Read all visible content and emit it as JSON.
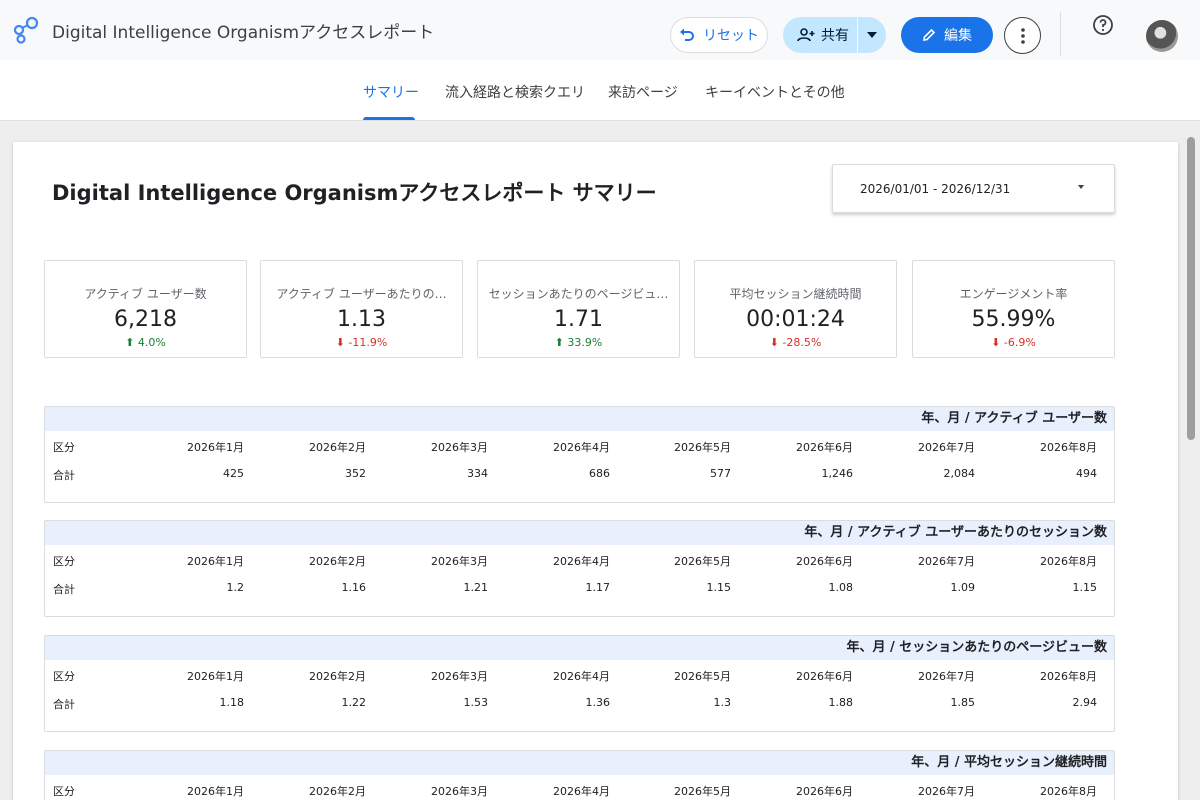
{
  "header": {
    "app_title": "Digital Intelligence Organismアクセスレポート",
    "reset_label": "リセット",
    "share_label": "共有",
    "edit_label": "編集"
  },
  "tabs": [
    {
      "label": "サマリー",
      "active": true
    },
    {
      "label": "流入経路と検索クエリ",
      "active": false
    },
    {
      "label": "来訪ページ",
      "active": false
    },
    {
      "label": "キーイベントとその他",
      "active": false
    }
  ],
  "report": {
    "title": "Digital Intelligence Organismアクセスレポート サマリー",
    "date_range": "2026/01/01 - 2026/12/31"
  },
  "kpis": [
    {
      "label": "アクティブ ユーザー数",
      "value": "6,218",
      "delta": "4.0%",
      "direction": "up"
    },
    {
      "label": "アクティブ ユーザーあたりの…",
      "value": "1.13",
      "delta": "-11.9%",
      "direction": "down"
    },
    {
      "label": "セッションあたりのページビュ…",
      "value": "1.71",
      "delta": "33.9%",
      "direction": "up"
    },
    {
      "label": "平均セッション継続時間",
      "value": "00:01:24",
      "delta": "-28.5%",
      "direction": "down"
    },
    {
      "label": "エンゲージメント率",
      "value": "55.99%",
      "delta": "-6.9%",
      "direction": "down"
    }
  ],
  "tables": [
    {
      "title": "年、月 / アクティブ ユーザー数",
      "columns": [
        "区分",
        "2026年1月",
        "2026年2月",
        "2026年3月",
        "2026年4月",
        "2026年5月",
        "2026年6月",
        "2026年7月",
        "2026年8月"
      ],
      "rows": [
        [
          "合計",
          "425",
          "352",
          "334",
          "686",
          "577",
          "1,246",
          "2,084",
          "494"
        ]
      ]
    },
    {
      "title": "年、月 / アクティブ ユーザーあたりのセッション数",
      "columns": [
        "区分",
        "2026年1月",
        "2026年2月",
        "2026年3月",
        "2026年4月",
        "2026年5月",
        "2026年6月",
        "2026年7月",
        "2026年8月"
      ],
      "rows": [
        [
          "合計",
          "1.2",
          "1.16",
          "1.21",
          "1.17",
          "1.15",
          "1.08",
          "1.09",
          "1.15"
        ]
      ]
    },
    {
      "title": "年、月 / セッションあたりのページビュー数",
      "columns": [
        "区分",
        "2026年1月",
        "2026年2月",
        "2026年3月",
        "2026年4月",
        "2026年5月",
        "2026年6月",
        "2026年7月",
        "2026年8月"
      ],
      "rows": [
        [
          "合計",
          "1.18",
          "1.22",
          "1.53",
          "1.36",
          "1.3",
          "1.88",
          "1.85",
          "2.94"
        ]
      ]
    },
    {
      "title": "年、月 / 平均セッション継続時間",
      "columns": [
        "区分",
        "2026年1月",
        "2026年2月",
        "2026年3月",
        "2026年4月",
        "2026年5月",
        "2026年6月",
        "2026年7月",
        "2026年8月"
      ],
      "rows": []
    }
  ],
  "colors": {
    "accent": "#1a73e8",
    "share_bg": "#c2e7ff",
    "positive": "#188038",
    "negative": "#d93025",
    "table_header_bg": "#e8f0fe"
  }
}
